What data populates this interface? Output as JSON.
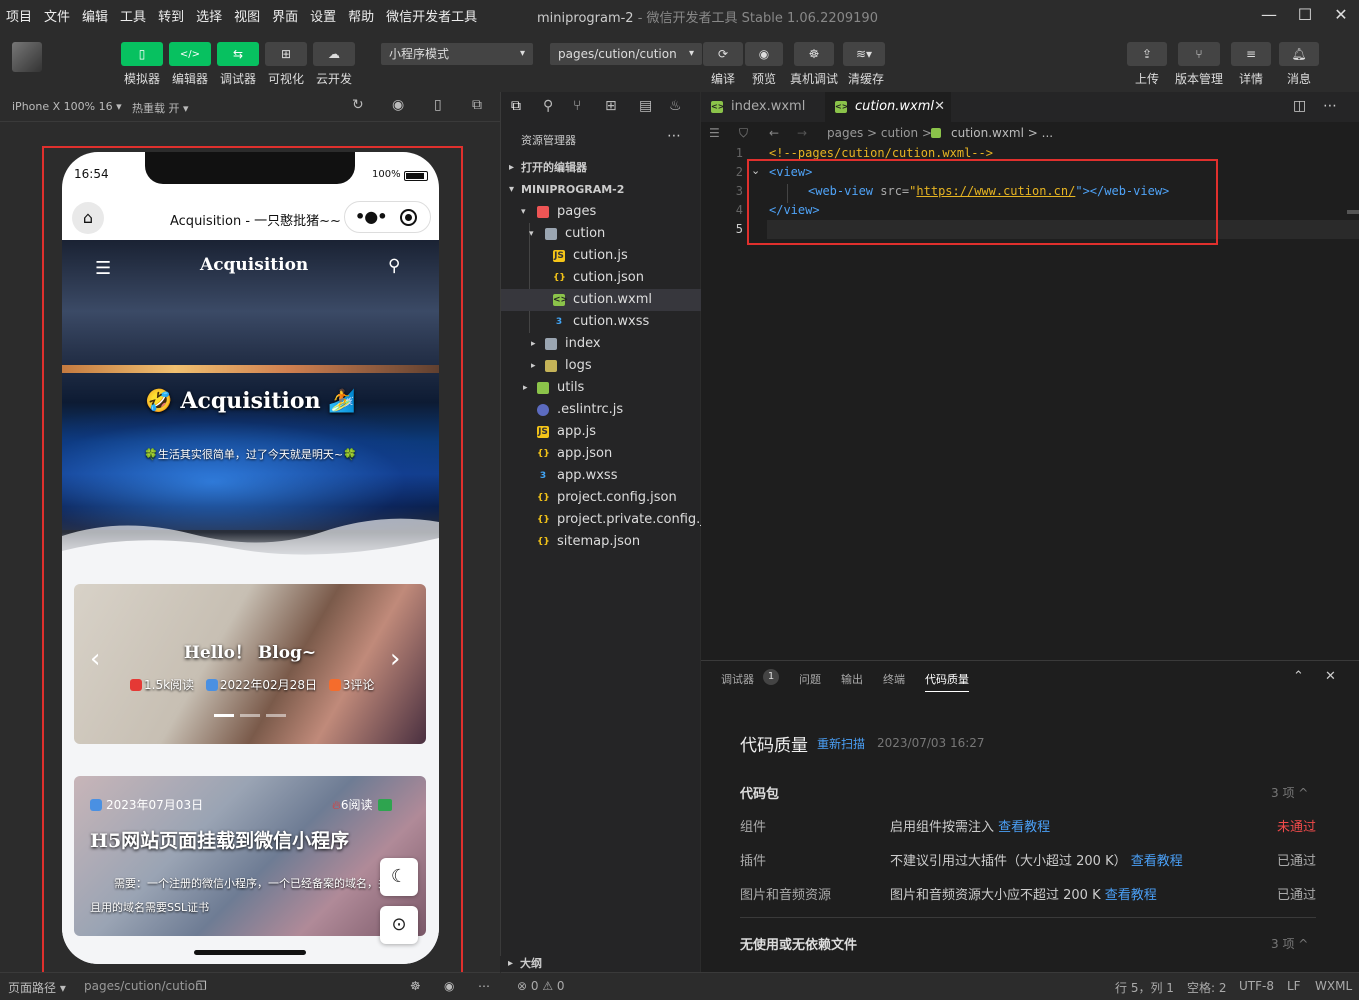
{
  "menu": [
    "项目",
    "文件",
    "编辑",
    "工具",
    "转到",
    "选择",
    "视图",
    "界面",
    "设置",
    "帮助",
    "微信开发者工具"
  ],
  "window": {
    "title": "miniprogram-2",
    "subtitle": " - 微信开发者工具 Stable 1.06.2209190"
  },
  "toolbar": {
    "simulator": "模拟器",
    "editor": "编辑器",
    "debugger": "调试器",
    "visual": "可视化",
    "cloud": "云开发",
    "mode": "小程序模式",
    "page": "pages/cution/cution",
    "compile": "编译",
    "preview": "预览",
    "remote_debug": "真机调试",
    "clear_cache": "清缓存",
    "upload": "上传",
    "version": "版本管理",
    "detail": "详情",
    "message": "消息"
  },
  "simulator": {
    "device": "iPhone X 100% 16 ▾",
    "hot_reload": "热重载 开 ▾",
    "time": "16:54",
    "battery": "100%",
    "nav_title": "Acquisition - 一只憨批猪~~",
    "hero_brand": "Acquisition",
    "hero_heading": "🤣 Acquisition 🏄",
    "hero_sub": "🍀生活其实很简单，过了今天就是明天~🍀",
    "card1": {
      "title": "Hello！ Blog~",
      "reads": "1.5k阅读",
      "date": "2022年02月28日",
      "comments": "3评论"
    },
    "card2": {
      "date": "2023年07月03日",
      "reads": "6阅读",
      "title": "H5网站页面挂载到微信小程序",
      "desc": "需要：一个注册的微信小程序，一个已经备案的域名，并且用的域名需要SSL证书"
    },
    "path_label": "页面路径 ▾",
    "path": "pages/cution/cution"
  },
  "explorer": {
    "title": "资源管理器",
    "open_editors": "打开的编辑器",
    "project": "MINIPROGRAM-2",
    "items": [
      {
        "name": "pages"
      },
      {
        "name": "cution"
      },
      {
        "name": "cution.js"
      },
      {
        "name": "cution.json"
      },
      {
        "name": "cution.wxml"
      },
      {
        "name": "cution.wxss"
      },
      {
        "name": "index"
      },
      {
        "name": "logs"
      },
      {
        "name": "utils"
      },
      {
        "name": ".eslintrc.js"
      },
      {
        "name": "app.js"
      },
      {
        "name": "app.json"
      },
      {
        "name": "app.wxss"
      },
      {
        "name": "project.config.json"
      },
      {
        "name": "project.private.config.js..."
      },
      {
        "name": "sitemap.json"
      }
    ],
    "outline": "大纲"
  },
  "editor": {
    "tabs": [
      "index.wxml",
      "cution.wxml"
    ],
    "breadcrumb": "pages > cution > ",
    "breadcrumb_file": "cution.wxml > ...",
    "lines": [
      "1",
      "2",
      "3",
      "4",
      "5"
    ],
    "code_comment": "<!--pages/cution/cution.wxml-->",
    "code_view_open": "<view>",
    "code_webview_a": "<web-view ",
    "code_src_attr": "src=",
    "code_quote": "\"",
    "code_url": "https://www.cution.cn/",
    "code_webview_b": "\"></web-view>",
    "code_view_close": "</view>"
  },
  "panel": {
    "tabs": [
      "调试器",
      "问题",
      "输出",
      "终端",
      "代码质量"
    ],
    "badge": "1",
    "heading": "代码质量",
    "rescan": "重新扫描",
    "date": "2023/07/03 16:27",
    "group1": "代码包",
    "group1_count": "3 项 ^",
    "rows": [
      {
        "k": "组件",
        "v": "启用组件按需注入",
        "link": "查看教程",
        "status": "未通过"
      },
      {
        "k": "插件",
        "v": "不建议引用过大插件（大小超过 200 K）",
        "link": "查看教程",
        "status": "已通过"
      },
      {
        "k": "图片和音频资源",
        "v": "图片和音频资源大小应不超过 200 K",
        "link": "查看教程",
        "status": "已通过"
      }
    ],
    "group2": "无使用或无依赖文件",
    "group2_count": "3 项 ^"
  },
  "statusbar": {
    "errors": "⊗ 0 ⚠ 0",
    "position": "行 5，列 1",
    "spaces": "空格: 2",
    "encoding": "UTF-8",
    "eol": "LF",
    "lang": "WXML"
  },
  "colors": {
    "accent_green": "#07c160",
    "red_box": "#e0302d",
    "link": "#4a9ff5",
    "fail": "#f04a4a"
  }
}
